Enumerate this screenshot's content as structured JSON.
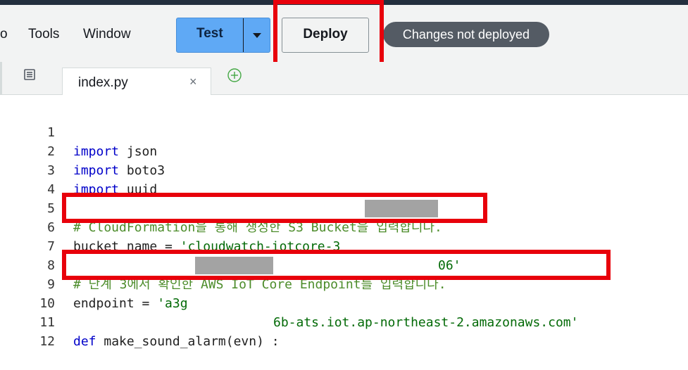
{
  "menu": {
    "items": [
      "o",
      "Tools",
      "Window"
    ]
  },
  "toolbar": {
    "test_label": "Test",
    "deploy_label": "Deploy",
    "status_badge": "Changes not deployed"
  },
  "tabs": [
    {
      "label": "index.py",
      "close": "×"
    }
  ],
  "editor": {
    "lines": [
      {
        "n": "1",
        "kw": "import",
        "rest": " json"
      },
      {
        "n": "2",
        "kw": "import",
        "rest": " boto3"
      },
      {
        "n": "3",
        "kw": "import",
        "rest": " uuid"
      },
      {
        "n": "4"
      },
      {
        "n": "5",
        "comment": "# CloudFormation을 통해 생성한 S3 Bucket을 입력합니다."
      },
      {
        "n": "6",
        "plain": "bucket_name = ",
        "str_a": "'cloudwatch-iotcore-3",
        "str_b": "06'"
      },
      {
        "n": "7"
      },
      {
        "n": "8",
        "comment": "# 단계 3에서 확인한 AWS IoT Core Endpoint를 입력합니다."
      },
      {
        "n": "9",
        "plain": "endpoint = ",
        "str_a": "'a3g",
        "str_b": "6b-ats.iot.ap-northeast-2.amazonaws.com'"
      },
      {
        "n": "10"
      },
      {
        "n": "11",
        "kw": "def",
        "rest": " make_sound_alarm(evn) :"
      },
      {
        "n": "12"
      }
    ]
  }
}
